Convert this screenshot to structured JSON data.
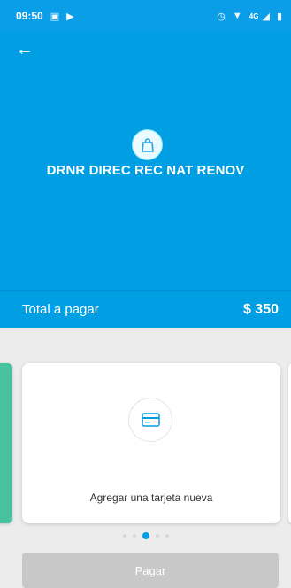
{
  "status_bar": {
    "time": "09:50",
    "network_label": "4G",
    "icons": [
      "sim-card-icon",
      "play-icon",
      "alarm-icon",
      "wifi-icon",
      "signal-icon",
      "battery-icon"
    ]
  },
  "header": {
    "back_icon": "back-arrow-icon",
    "merchant_icon": "shopping-bag-icon",
    "merchant_name": "DRNR DIREC REC NAT RENOV"
  },
  "summary": {
    "label": "Total a pagar",
    "amount": "$ 350"
  },
  "payment_method": {
    "card_icon": "credit-card-icon",
    "label": "Agregar una tarjeta nueva"
  },
  "pagination": {
    "total": 5,
    "active": 3
  },
  "actions": {
    "pay_label": "Pagar",
    "pay_enabled": false
  },
  "colors": {
    "primary": "#009ee3",
    "disabled_button": "#c8c8c8",
    "left_card": "#47c19f",
    "background": "#ececec"
  }
}
